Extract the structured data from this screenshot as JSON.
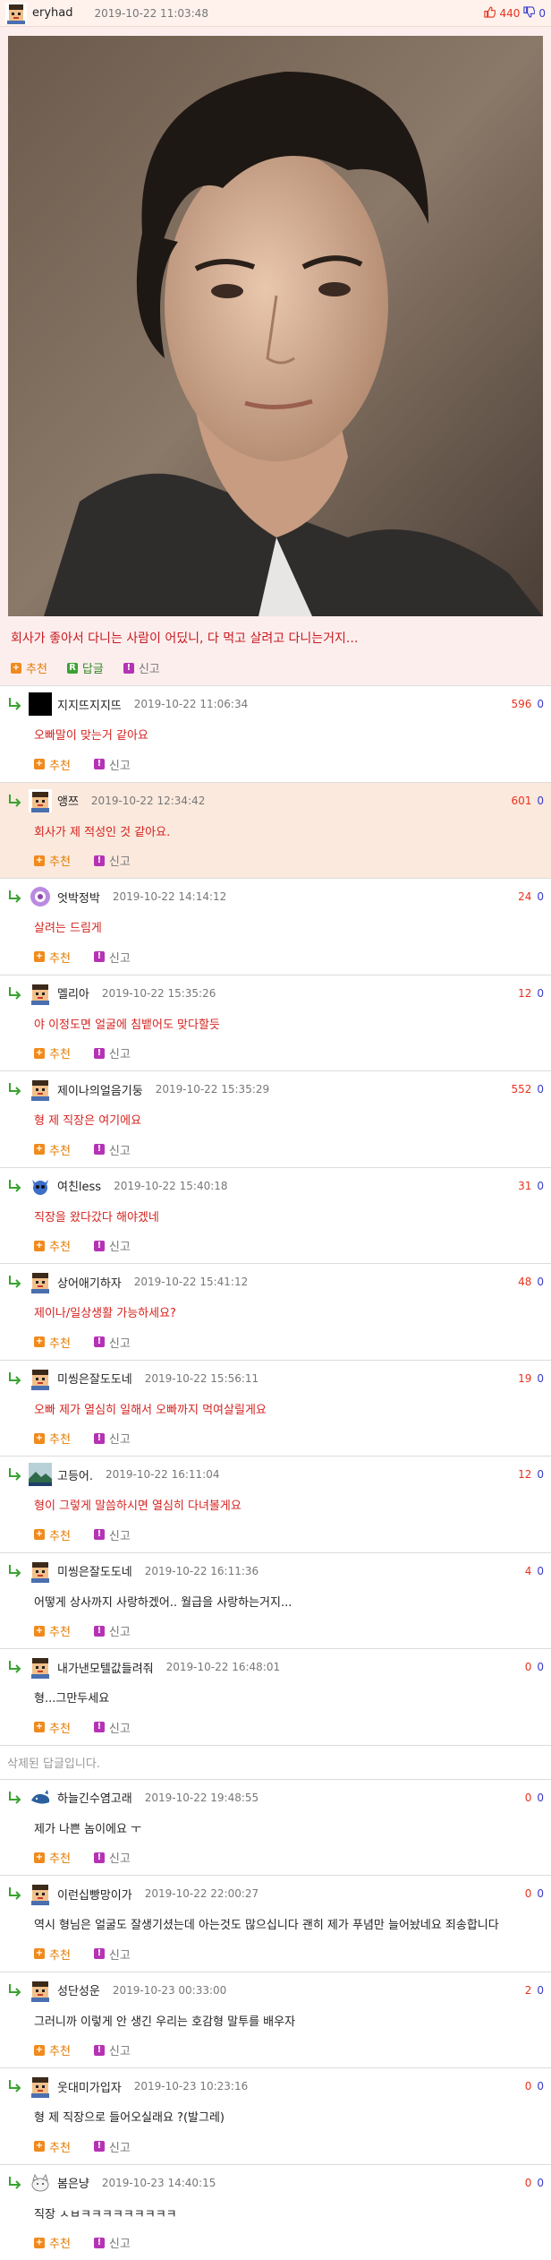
{
  "post": {
    "username": "eryhad",
    "timestamp": "2019-10-22 11:03:48",
    "up_count": "440",
    "down_count": "0",
    "text": "회사가 좋아서 다니는 사람이 어딨니, 다 먹고 살려고 다니는거지...",
    "actions": {
      "recommend": "추천",
      "reply": "답글",
      "report": "신고"
    }
  },
  "deleted_notice": "삭제된 답글입니다.",
  "comments": [
    {
      "user": "지지뜨지지뜨",
      "time": "2019-10-22 11:06:34",
      "up": "596",
      "down": "0",
      "text": "오빠말이 맞는거 같아요",
      "avatar": "black-square"
    },
    {
      "user": "앵쯔",
      "time": "2019-10-22 12:34:42",
      "up": "601",
      "down": "0",
      "text": "회사가 제 적성인 것 같아요.",
      "avatar": "face"
    },
    {
      "user": "엇박정박",
      "time": "2019-10-22 14:14:12",
      "up": "24",
      "down": "0",
      "text": "살려는 드림게",
      "avatar": "purple-circle"
    },
    {
      "user": "멜리아",
      "time": "2019-10-22 15:35:26",
      "up": "12",
      "down": "0",
      "text": "야 이정도면 얼굴에 침뱉어도 맞다할듯",
      "avatar": "face"
    },
    {
      "user": "제이나의얼음기둥",
      "time": "2019-10-22 15:35:29",
      "up": "552",
      "down": "0",
      "text": "형 제 직장은 여기에요",
      "avatar": "face"
    },
    {
      "user": "여친less",
      "time": "2019-10-22 15:40:18",
      "up": "31",
      "down": "0",
      "text": "직장을 왔다갔다 해야겠네",
      "avatar": "stitch"
    },
    {
      "user": "상어애기하자",
      "time": "2019-10-22 15:41:12",
      "up": "48",
      "down": "0",
      "text": "제이나/일상생활 가능하세요?",
      "avatar": "face"
    },
    {
      "user": "미씽은잘도도네",
      "time": "2019-10-22 15:56:11",
      "up": "19",
      "down": "0",
      "text": "오빠 제가 열심히 일해서 오빠까지 먹여살릴게요",
      "avatar": "face"
    },
    {
      "user": "고등어.",
      "time": "2019-10-22 16:11:04",
      "up": "12",
      "down": "0",
      "text": "형이 그렇게 말씀하시면 열심히 다녀볼게요",
      "avatar": "landscape"
    },
    {
      "user": "미씽은잘도도네",
      "time": "2019-10-22 16:11:36",
      "up": "4",
      "down": "0",
      "text": "어떻게 상사까지 사랑하겠어.. 월급을 사랑하는거지...",
      "avatar": "face"
    },
    {
      "user": "내가낸모텔값들려줘",
      "time": "2019-10-22 16:48:01",
      "up": "0",
      "down": "0",
      "text": "형...그만두세요",
      "avatar": "face"
    },
    {
      "user": "하늘긴수염고래",
      "time": "2019-10-22 19:48:55",
      "up": "0",
      "down": "0",
      "text": "제가 나쁜 놈이에요 ㅜ",
      "avatar": "whale"
    },
    {
      "user": "이런십빵망이가",
      "time": "2019-10-22 22:00:27",
      "up": "0",
      "down": "0",
      "text": "역시 형님은 얼굴도 잘생기셨는데 아는것도 많으십니다 괜히 제가 푸념만 늘어놨네요 죄송합니다",
      "avatar": "face"
    },
    {
      "user": "성단성운",
      "time": "2019-10-23 00:33:00",
      "up": "2",
      "down": "0",
      "text": "그러니까 이렇게 안 생긴 우리는 호감형 말투를 배우자",
      "avatar": "face"
    },
    {
      "user": "웃대미가입자",
      "time": "2019-10-23 10:23:16",
      "up": "0",
      "down": "0",
      "text": "형 제 직장으로 들어오실래요 ?(발그레)",
      "avatar": "face"
    },
    {
      "user": "봄은냥",
      "time": "2019-10-23 14:40:15",
      "up": "0",
      "down": "0",
      "text": "직장 ㅅㅂㅋㅋㅋㅋㅋㅋㅋㅋㅋ",
      "avatar": "cat"
    }
  ],
  "colors": {
    "accent_red": "#d5231f",
    "up_red": "#e8321e",
    "down_blue": "#3a3acd",
    "highlight": "#fbe9dd"
  }
}
